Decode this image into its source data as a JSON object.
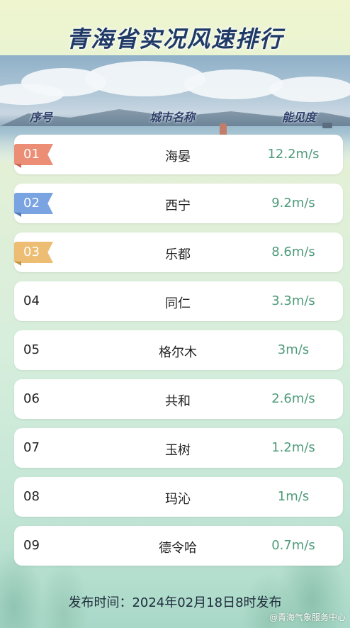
{
  "title": "青海省实况风速排行",
  "header": {
    "rank": "序号",
    "city": "城市名称",
    "value": "能见度"
  },
  "colors": {
    "rank1": "#ec8d76",
    "rank2": "#7aa3e2",
    "rank3": "#ecbd72",
    "value_text": "#4f9a7a",
    "title": "#1f3a66"
  },
  "rows": [
    {
      "rank": "01",
      "city": "海晏",
      "value": "12.2m/s"
    },
    {
      "rank": "02",
      "city": "西宁",
      "value": "9.2m/s"
    },
    {
      "rank": "03",
      "city": "乐都",
      "value": "8.6m/s"
    },
    {
      "rank": "04",
      "city": "同仁",
      "value": "3.3m/s"
    },
    {
      "rank": "05",
      "city": "格尔木",
      "value": "3m/s"
    },
    {
      "rank": "06",
      "city": "共和",
      "value": "2.6m/s"
    },
    {
      "rank": "07",
      "city": "玉树",
      "value": "1.2m/s"
    },
    {
      "rank": "08",
      "city": "玛沁",
      "value": "1m/s"
    },
    {
      "rank": "09",
      "city": "德令哈",
      "value": "0.7m/s"
    }
  ],
  "footer": "发布时间：2024年02月18日8时发布",
  "watermark": "@青海气象服务中心"
}
